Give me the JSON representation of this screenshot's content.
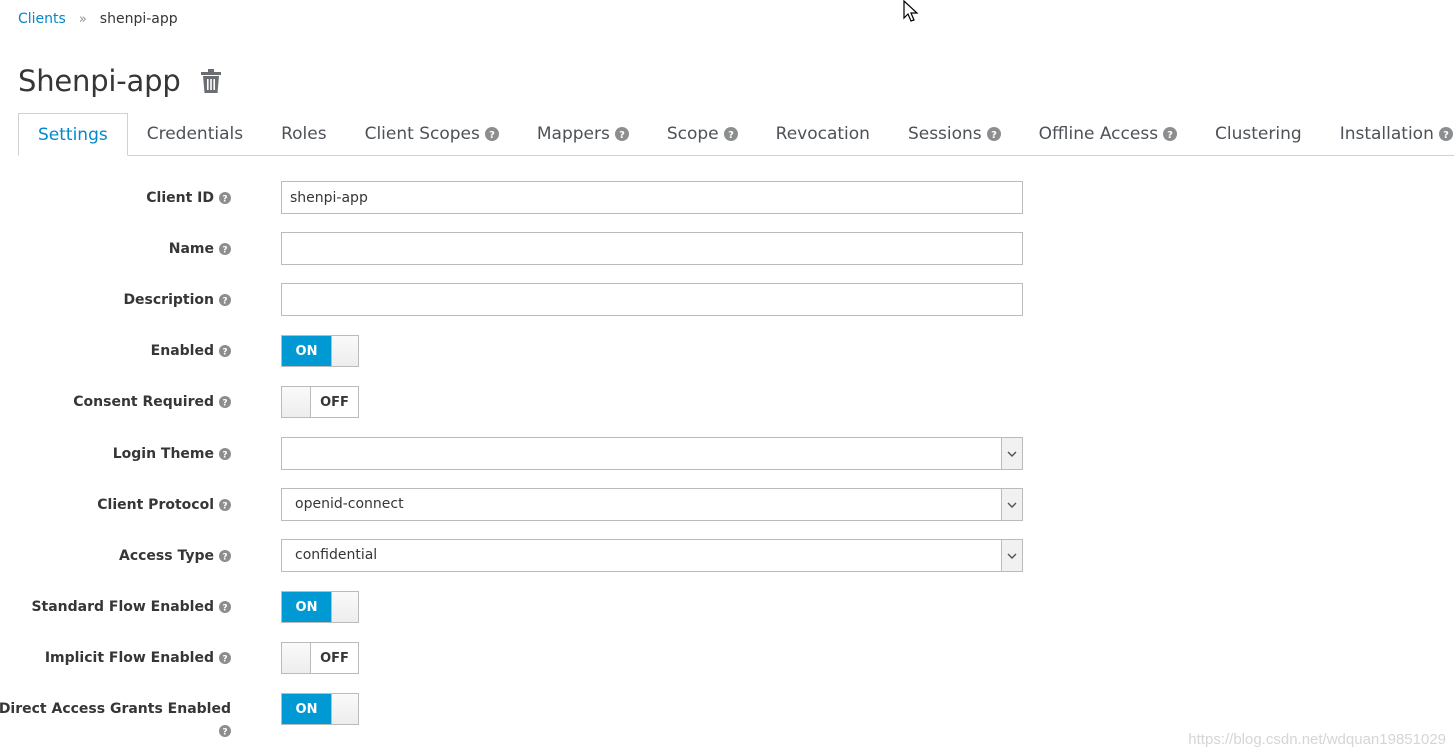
{
  "breadcrumb": {
    "parent": "Clients",
    "separator": "»",
    "current": "shenpi-app"
  },
  "page": {
    "title": "Shenpi-app"
  },
  "tabs": [
    {
      "label": "Settings",
      "active": true,
      "help": false
    },
    {
      "label": "Credentials",
      "active": false,
      "help": false
    },
    {
      "label": "Roles",
      "active": false,
      "help": false
    },
    {
      "label": "Client Scopes",
      "active": false,
      "help": true
    },
    {
      "label": "Mappers",
      "active": false,
      "help": true
    },
    {
      "label": "Scope",
      "active": false,
      "help": true
    },
    {
      "label": "Revocation",
      "active": false,
      "help": false
    },
    {
      "label": "Sessions",
      "active": false,
      "help": true
    },
    {
      "label": "Offline Access",
      "active": false,
      "help": true
    },
    {
      "label": "Clustering",
      "active": false,
      "help": false
    },
    {
      "label": "Installation",
      "active": false,
      "help": true
    }
  ],
  "form": {
    "client_id": {
      "label": "Client ID",
      "value": "shenpi-app"
    },
    "name": {
      "label": "Name",
      "value": ""
    },
    "description": {
      "label": "Description",
      "value": ""
    },
    "enabled": {
      "label": "Enabled",
      "state": "ON"
    },
    "consent_required": {
      "label": "Consent Required",
      "state": "OFF"
    },
    "login_theme": {
      "label": "Login Theme",
      "value": ""
    },
    "client_protocol": {
      "label": "Client Protocol",
      "value": "openid-connect"
    },
    "access_type": {
      "label": "Access Type",
      "value": "confidential"
    },
    "standard_flow": {
      "label": "Standard Flow Enabled",
      "state": "ON"
    },
    "implicit_flow": {
      "label": "Implicit Flow Enabled",
      "state": "OFF"
    },
    "direct_access": {
      "label": "Direct Access Grants Enabled",
      "state": "ON"
    }
  },
  "watermark": "https://blog.csdn.net/wdquan19851029",
  "colors": {
    "accent": "#0088ce",
    "switch_on": "#0099d3",
    "text": "#363636",
    "border": "#bbbbbb"
  },
  "icons": {
    "trash": "trash-icon",
    "help": "question-circle-icon",
    "caret": "chevron-down-icon"
  }
}
